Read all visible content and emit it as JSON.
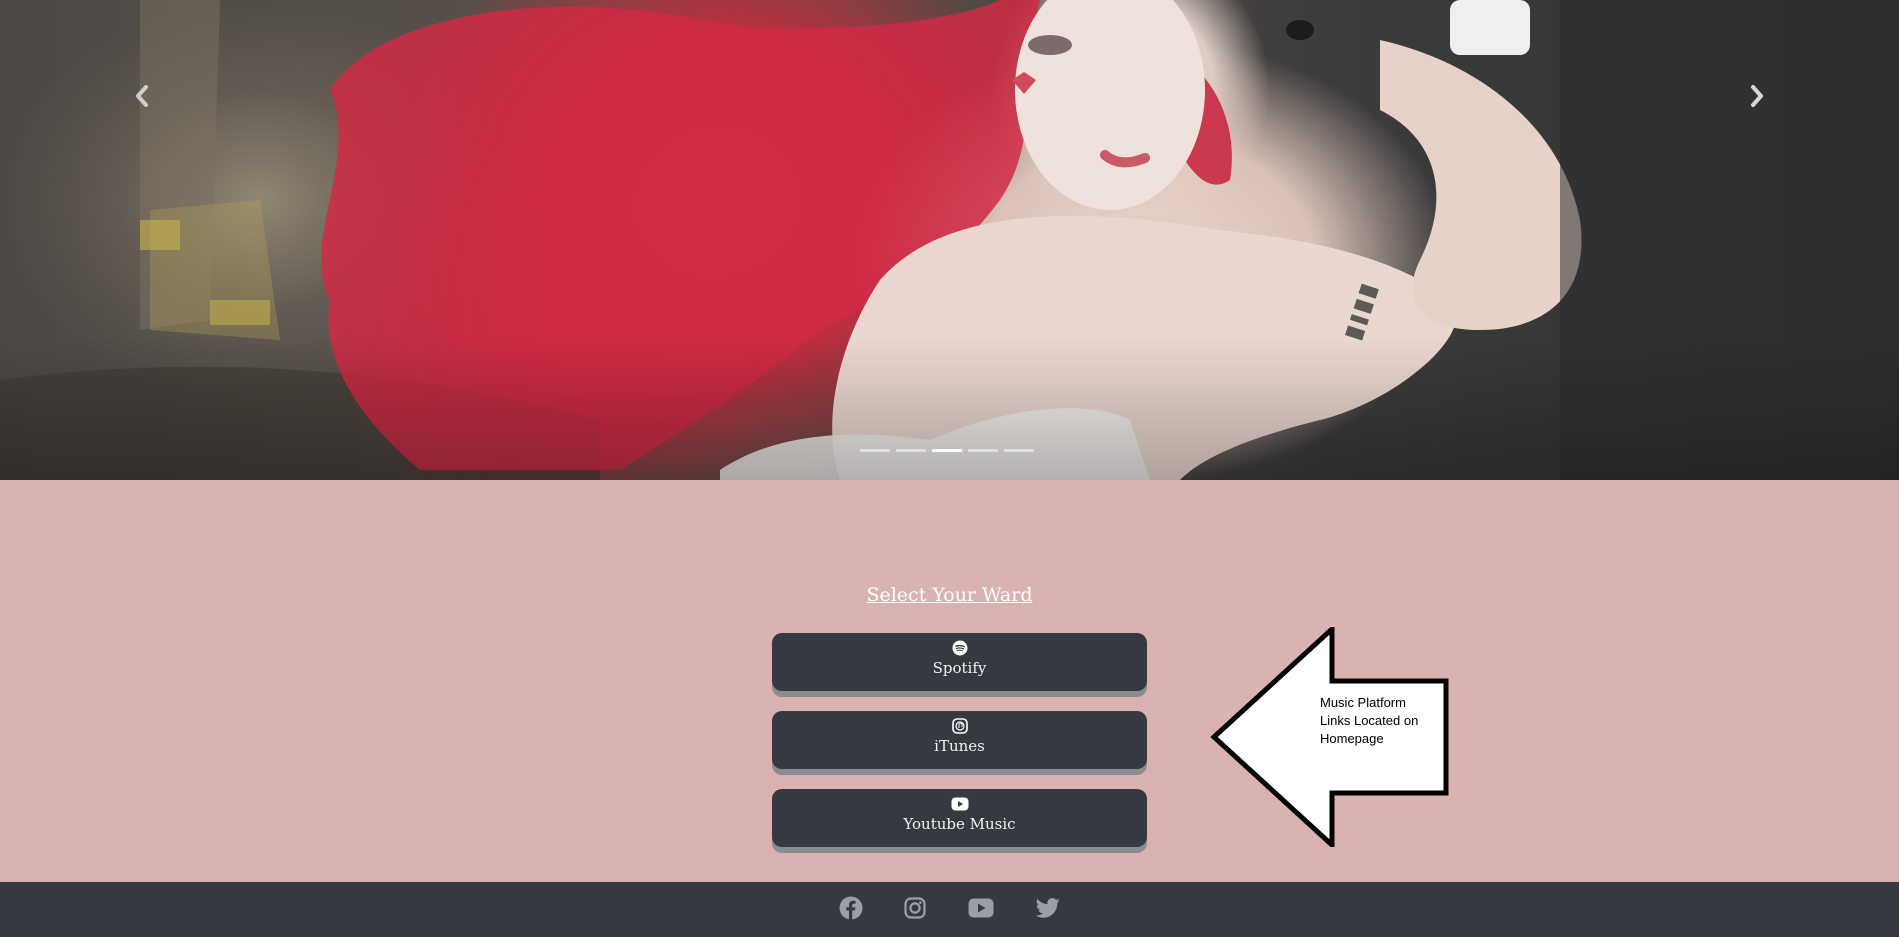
{
  "hero": {
    "image_alt": "Woman with long red hair looking over her shoulder against a rusted metal wall",
    "prev_icon": "chevron-left-icon",
    "next_icon": "chevron-right-icon",
    "slide_count": 5,
    "active_slide": 3
  },
  "links_section": {
    "title": "Select Your Ward",
    "buttons": [
      {
        "icon": "spotify-icon",
        "label": "Spotify"
      },
      {
        "icon": "itunes-icon",
        "label": "iTunes"
      },
      {
        "icon": "youtube-icon",
        "label": "Youtube Music"
      }
    ]
  },
  "annotation": {
    "text": "Music Platform Links Located on Homepage",
    "icon": "left-arrow-callout"
  },
  "footer": {
    "social_icons": [
      "facebook-icon",
      "instagram-icon",
      "youtube-icon",
      "twitter-icon"
    ]
  },
  "colors": {
    "page_background": "#dab2b2",
    "button_background": "#343a40",
    "button_shadow": "#8a8c90",
    "footer_background": "#343a40",
    "footer_icon": "#9aa0a6",
    "title_text": "#ffffff"
  }
}
